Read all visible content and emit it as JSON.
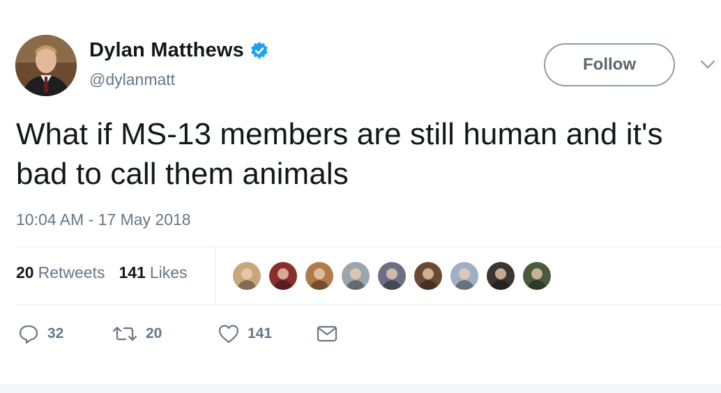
{
  "author": {
    "display_name": "Dylan Matthews",
    "handle": "@dylanmatt",
    "verified": true,
    "avatar_icon": "profile-photo"
  },
  "follow_button": {
    "label": "Follow"
  },
  "tweet": {
    "text": "What if MS-13 members are still human and it's bad to call them animals",
    "timestamp": "10:04 AM - 17 May 2018"
  },
  "stats": {
    "retweets_count": "20",
    "retweets_label": "Retweets",
    "likes_count": "141",
    "likes_label": "Likes"
  },
  "liker_avatars": [
    "#c9a77a",
    "#8a2d2d",
    "#b07a4a",
    "#9aa5ad",
    "#6e6f86",
    "#6b4a33",
    "#9fb0c4",
    "#3b3430",
    "#4a5a3c"
  ],
  "actions": {
    "reply_count": "32",
    "retweet_count": "20",
    "like_count": "141"
  },
  "colors": {
    "verified": "#1da1f2",
    "muted": "#657786",
    "text": "#14171a"
  }
}
